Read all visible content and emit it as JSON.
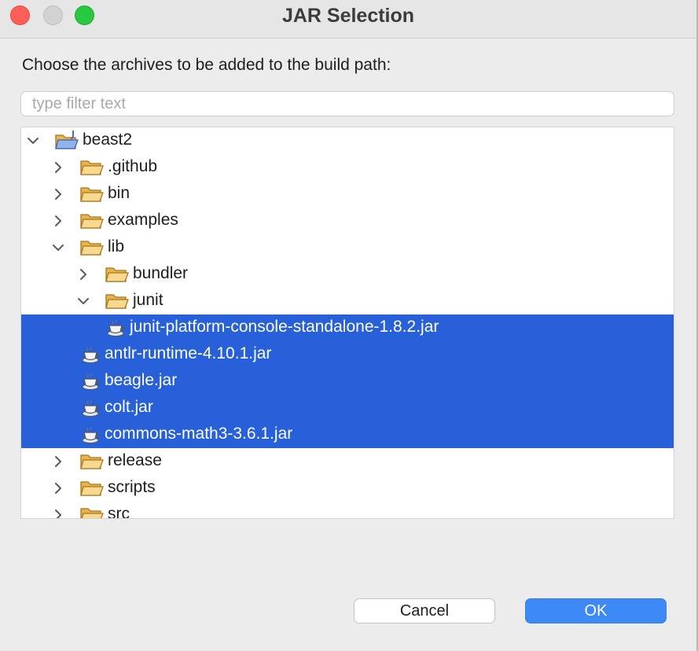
{
  "window": {
    "title": "JAR Selection",
    "controls": [
      "close",
      "minimize",
      "zoom"
    ]
  },
  "prompt": "Choose the archives to be added to the build path:",
  "filter": {
    "placeholder": "type filter text",
    "value": ""
  },
  "tree": {
    "rows": [
      {
        "label": "beast2",
        "type": "project",
        "state": "expanded",
        "selected": false
      },
      {
        "label": ".github",
        "type": "folder",
        "state": "collapsed",
        "selected": false
      },
      {
        "label": "bin",
        "type": "folder",
        "state": "collapsed",
        "selected": false
      },
      {
        "label": "examples",
        "type": "folder",
        "state": "collapsed",
        "selected": false
      },
      {
        "label": "lib",
        "type": "folder",
        "state": "expanded",
        "selected": false
      },
      {
        "label": "bundler",
        "type": "folder",
        "state": "collapsed",
        "selected": false
      },
      {
        "label": "junit",
        "type": "folder",
        "state": "expanded",
        "selected": false
      },
      {
        "label": "junit-platform-console-standalone-1.8.2.jar",
        "type": "jar",
        "state": "leaf",
        "selected": true
      },
      {
        "label": "antlr-runtime-4.10.1.jar",
        "type": "jar",
        "state": "leaf",
        "selected": true
      },
      {
        "label": "beagle.jar",
        "type": "jar",
        "state": "leaf",
        "selected": true
      },
      {
        "label": "colt.jar",
        "type": "jar",
        "state": "leaf",
        "selected": true
      },
      {
        "label": "commons-math3-3.6.1.jar",
        "type": "jar",
        "state": "leaf",
        "selected": true
      },
      {
        "label": "release",
        "type": "folder",
        "state": "collapsed",
        "selected": false
      },
      {
        "label": "scripts",
        "type": "folder",
        "state": "collapsed",
        "selected": false
      },
      {
        "label": "src",
        "type": "folder",
        "state": "collapsed",
        "selected": false
      }
    ]
  },
  "buttons": {
    "cancel": "Cancel",
    "ok": "OK"
  },
  "colors": {
    "selection": "#2760d8",
    "ok_button": "#3d8af7",
    "folder": "#f5cf7a"
  }
}
